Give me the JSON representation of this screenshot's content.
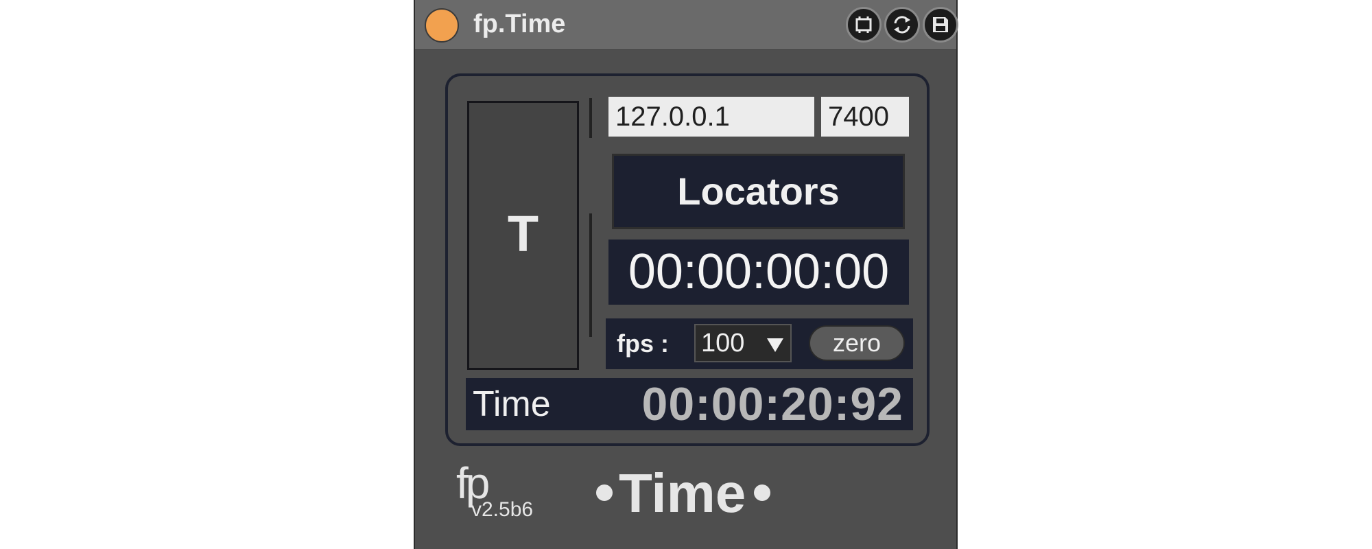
{
  "window": {
    "title": "fp.Time",
    "icons": [
      "window-icon",
      "refresh-icon",
      "save-icon"
    ]
  },
  "left_panel": {
    "letter": "T"
  },
  "network": {
    "ip": "127.0.0.1",
    "port": "7400"
  },
  "locators": {
    "label": "Locators",
    "time": "00:00:00:00"
  },
  "fps": {
    "label": "fps :",
    "value": "100",
    "zero_label": "zero"
  },
  "time_display": {
    "label": "Time",
    "value": "00:00:20:92"
  },
  "footer": {
    "brand": "fp",
    "version": "v2.5b6",
    "logo": "Time"
  },
  "colors": {
    "led": "#f2a14f",
    "panel_dark": "#1c2030",
    "device_bg": "#4e4e4e",
    "titlebar": "#6a6a6a",
    "text": "#f0f0f0"
  }
}
